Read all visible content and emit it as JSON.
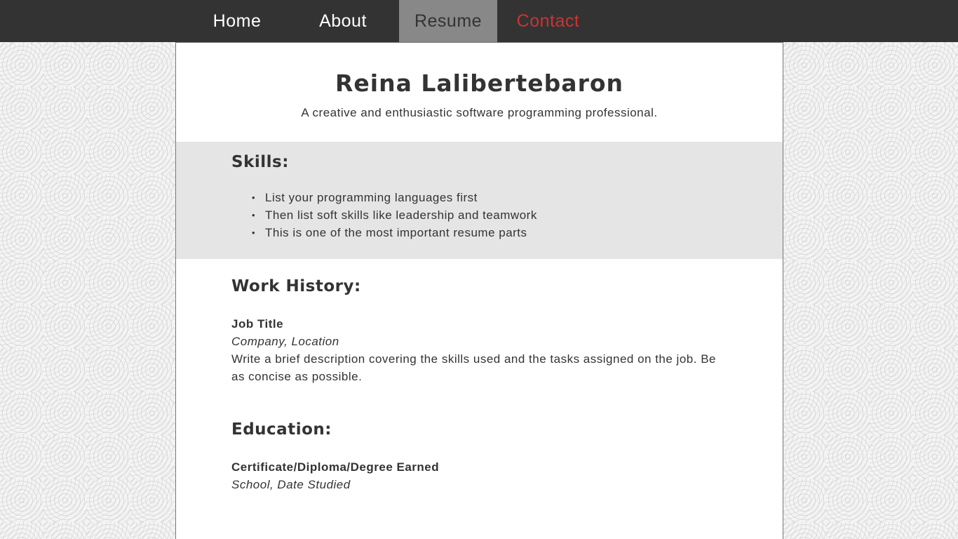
{
  "nav": {
    "items": [
      {
        "label": "Home"
      },
      {
        "label": "About"
      },
      {
        "label": "Resume"
      },
      {
        "label": "Contact"
      }
    ],
    "active": "Resume",
    "colors": {
      "bar": "#333333",
      "active_bg": "#888888",
      "contact": "#cc3333"
    }
  },
  "header": {
    "name": "Reina Lalibertebaron",
    "tagline": "A creative and enthusiastic software programming professional."
  },
  "skills": {
    "title": "Skills:",
    "items": [
      "List your programming languages first",
      "Then list soft skills like leadership and teamwork",
      "This is one of the most important resume parts"
    ]
  },
  "work": {
    "title": "Work History:",
    "job_title": "Job Title",
    "company": "Company, Location",
    "description": "Write a brief description covering the skills used and the tasks assigned on the job. Be as concise as possible."
  },
  "education": {
    "title": "Education:",
    "degree": "Certificate/Diploma/Degree Earned",
    "school": "School, Date Studied"
  }
}
